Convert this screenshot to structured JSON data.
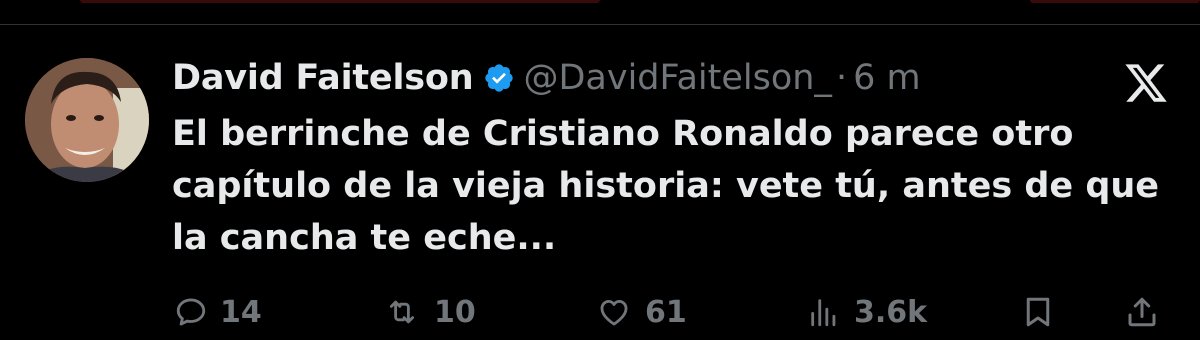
{
  "tweet": {
    "author": {
      "display_name": "David Faitelson",
      "handle": "@DavidFaitelson_",
      "verified": true,
      "avatar_icon": "profile-photo"
    },
    "separator": "·",
    "time": "6 m",
    "platform_icon": "x-logo-icon",
    "text": "El berrinche de Cristiano Ronaldo parece otro capítulo de la vieja historia: vete tú, antes de que la cancha te eche..."
  },
  "actions": {
    "replies": {
      "icon": "reply-icon",
      "count": "14"
    },
    "reposts": {
      "icon": "repost-icon",
      "count": "10"
    },
    "likes": {
      "icon": "like-icon",
      "count": "61"
    },
    "views": {
      "icon": "views-icon",
      "count": "3.6k"
    },
    "bookmark": {
      "icon": "bookmark-icon"
    },
    "share": {
      "icon": "share-icon"
    }
  },
  "colors": {
    "background": "#000000",
    "text_primary": "#e7e9ea",
    "text_secondary": "#71767b",
    "verified_badge": "#1d9bf0"
  }
}
